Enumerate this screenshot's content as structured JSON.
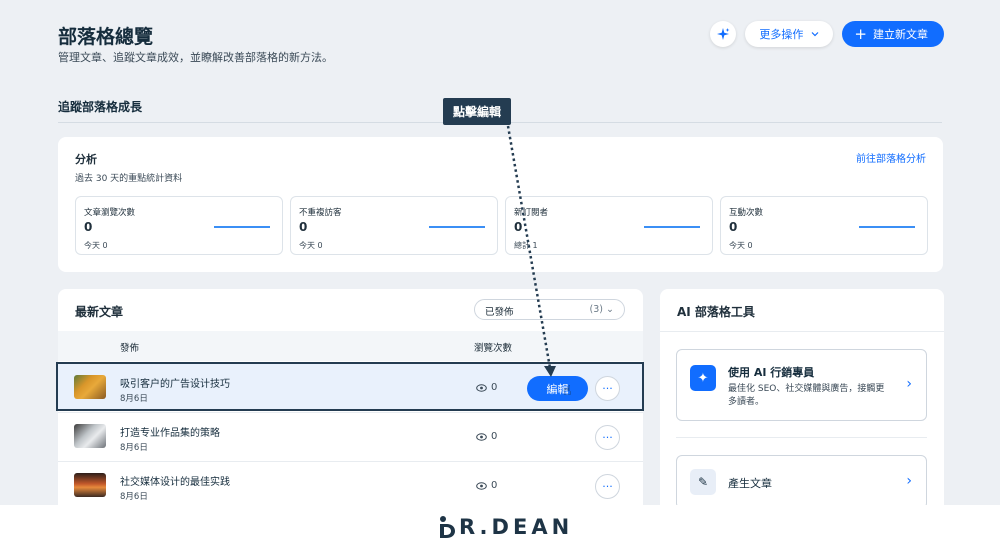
{
  "header": {
    "title": "部落格總覽",
    "subtitle": "管理文章、追蹤文章成效，並瞭解改善部落格的新方法。",
    "more_actions_label": "更多操作",
    "new_post_label": "建立新文章"
  },
  "growth": {
    "section_title": "追蹤部落格成長",
    "analytics_title": "分析",
    "analytics_sub": "過去 30 天的重點統計資料",
    "analytics_link": "前往部落格分析",
    "stats": [
      {
        "label": "文章瀏覽次數",
        "value": "0",
        "sub": "今天 0"
      },
      {
        "label": "不重複訪客",
        "value": "0",
        "sub": "今天 0"
      },
      {
        "label": "新訂閱者",
        "value": "0",
        "sub": "總計 1"
      },
      {
        "label": "互動次數",
        "value": "0",
        "sub": "今天 0"
      }
    ]
  },
  "posts": {
    "title": "最新文章",
    "filter_value": "已發佈",
    "filter_count": "(3)",
    "col_published": "發佈",
    "col_views": "瀏覽次數",
    "edit_label": "編輯",
    "more_label": "···",
    "rows": [
      {
        "title": "吸引客户的广告设计技巧",
        "date": "8月6日",
        "views": "0"
      },
      {
        "title": "打造专业作品集的策略",
        "date": "8月6日",
        "views": "0"
      },
      {
        "title": "社交媒体设计的最佳实践",
        "date": "8月6日",
        "views": "0"
      }
    ]
  },
  "ai_tools": {
    "title": "AI 部落格工具",
    "tool1_name": "使用 AI 行銷專員",
    "tool1_desc": "最佳化 SEO、社交媒體與廣告，接觸更多讀者。",
    "tool2_name": "產生文章"
  },
  "annotation": {
    "tooltip": "點擊編輯"
  },
  "footer": {
    "logo_text": "R.DEAN"
  },
  "colors": {
    "accent": "#116dff",
    "annotation": "#243c51",
    "background": "#edf0f4"
  }
}
